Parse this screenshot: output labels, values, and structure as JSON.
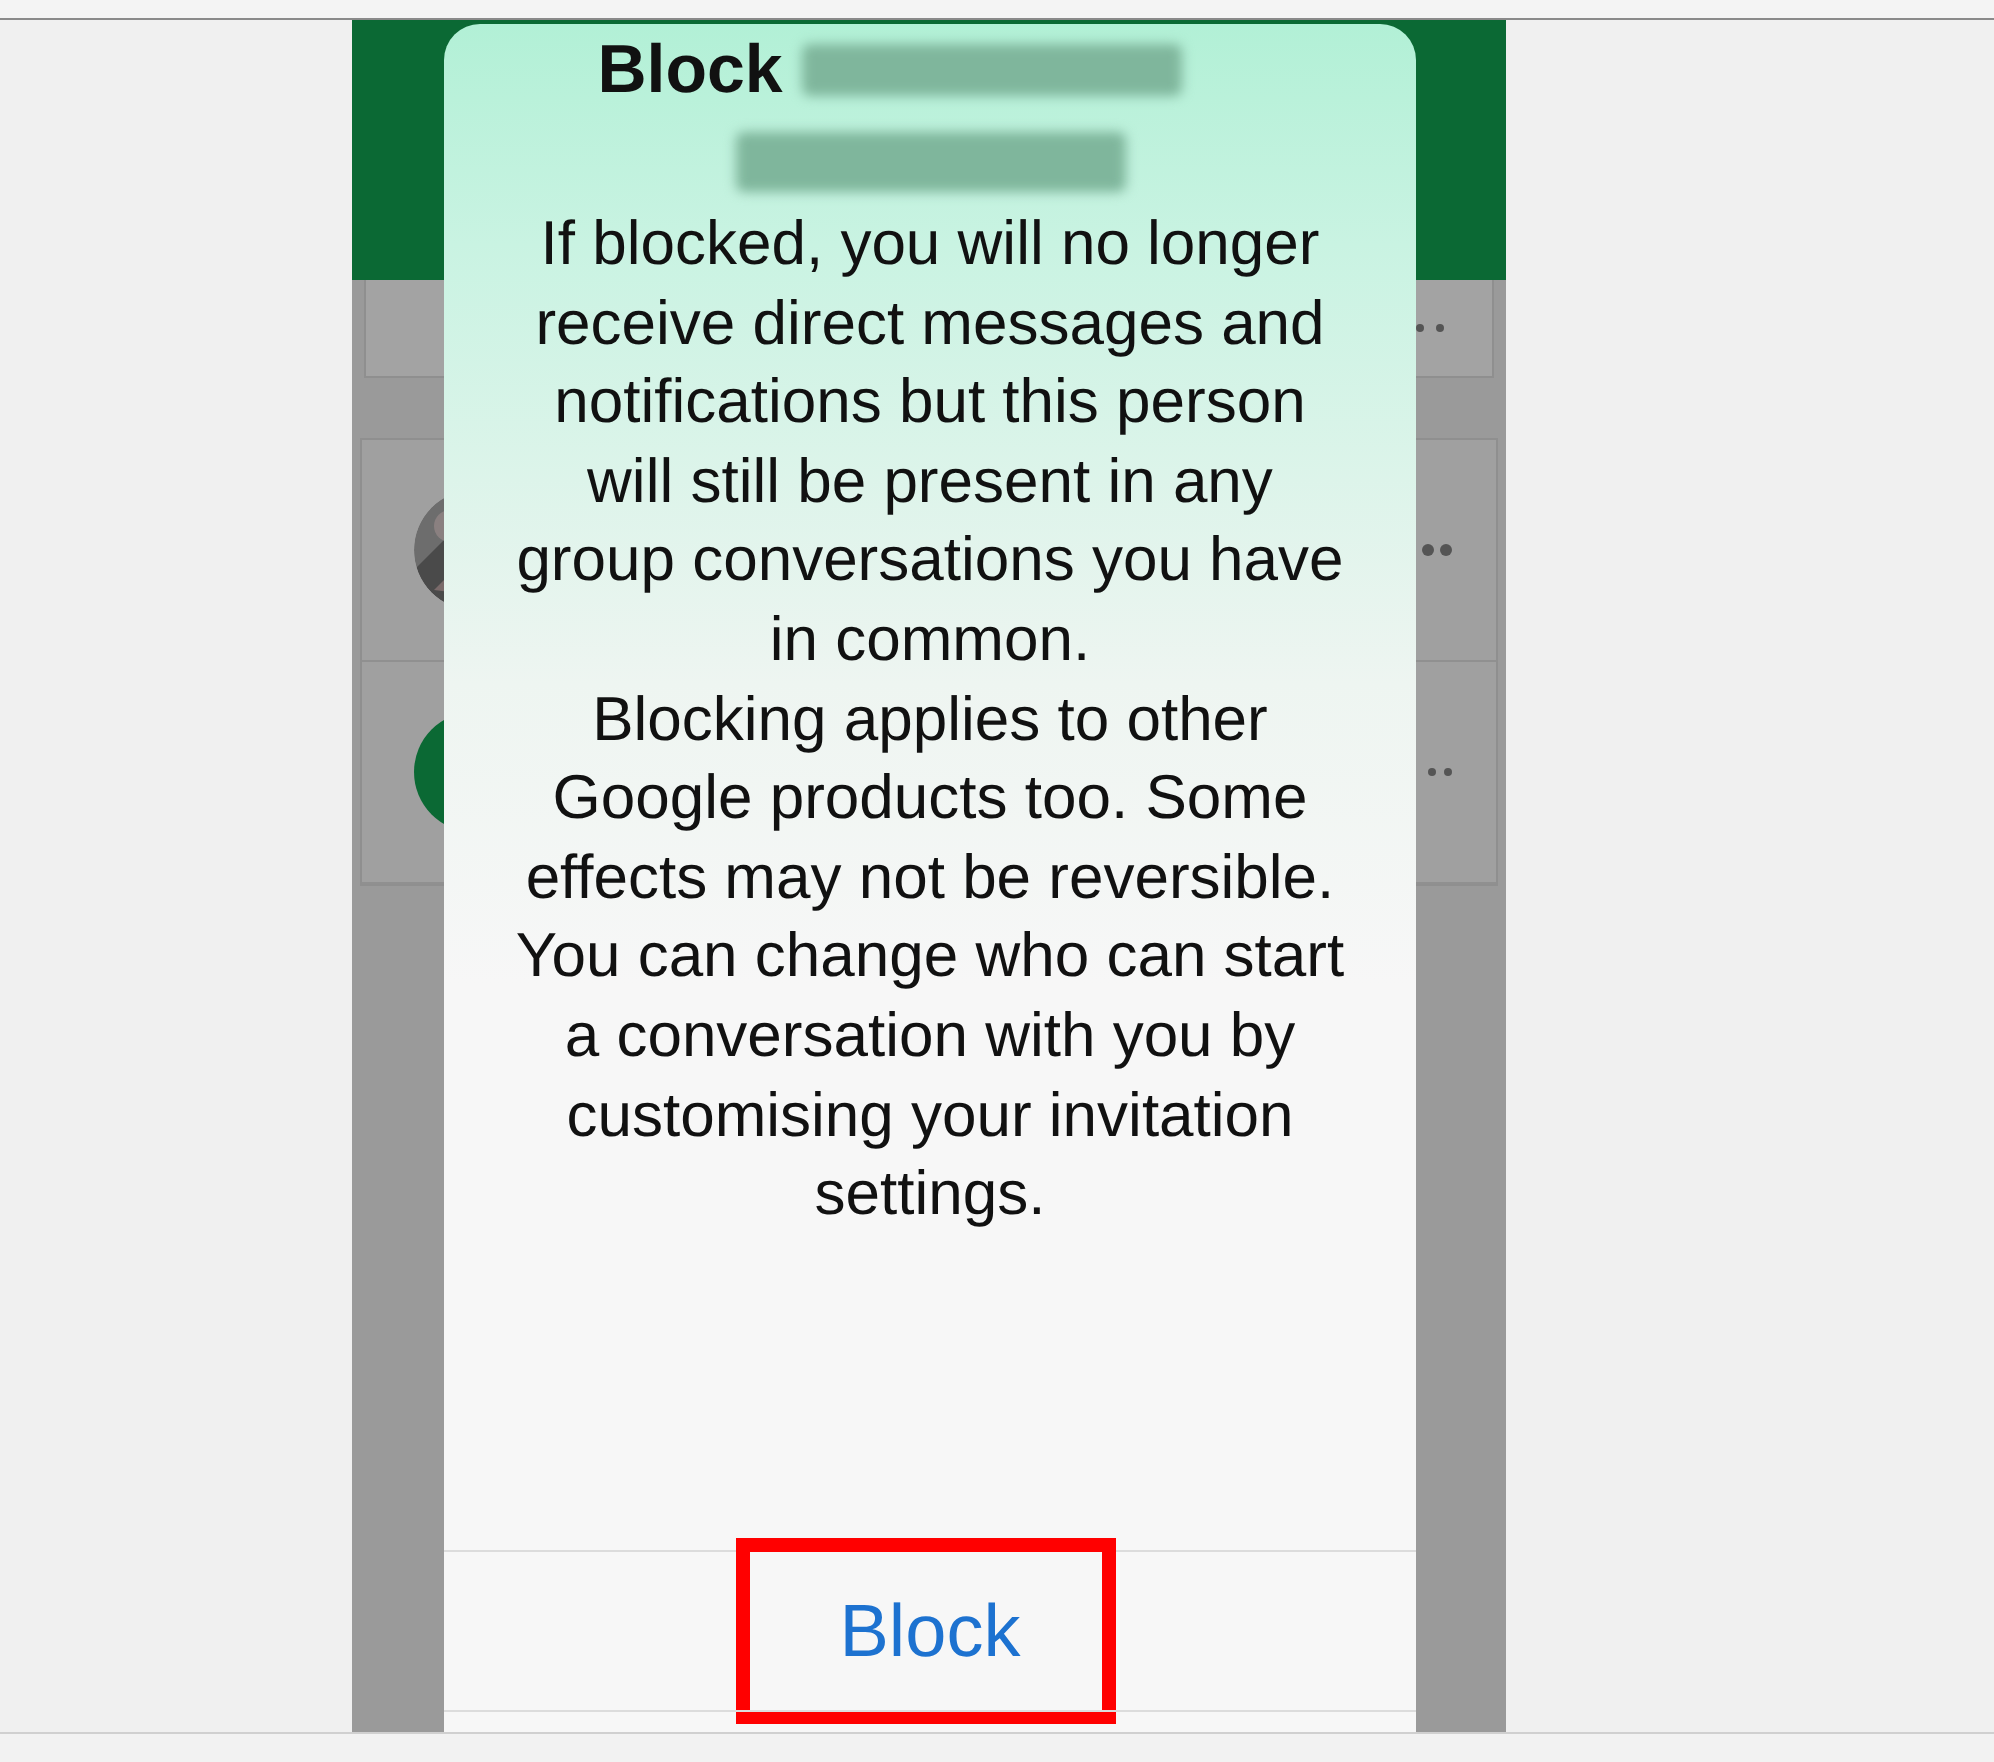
{
  "dialog": {
    "title": "Block",
    "paragraphs": [
      "If blocked, you will no longer receive direct messages and notifications but this person will still be present in any group conversations you have in common.",
      "Blocking applies to other Google products too. Some effects may not be reversible.",
      "You can change who can start a conversation with you by customising your invitation settings."
    ],
    "buttons": [
      {
        "label": "Block",
        "highlighted": true
      }
    ]
  }
}
